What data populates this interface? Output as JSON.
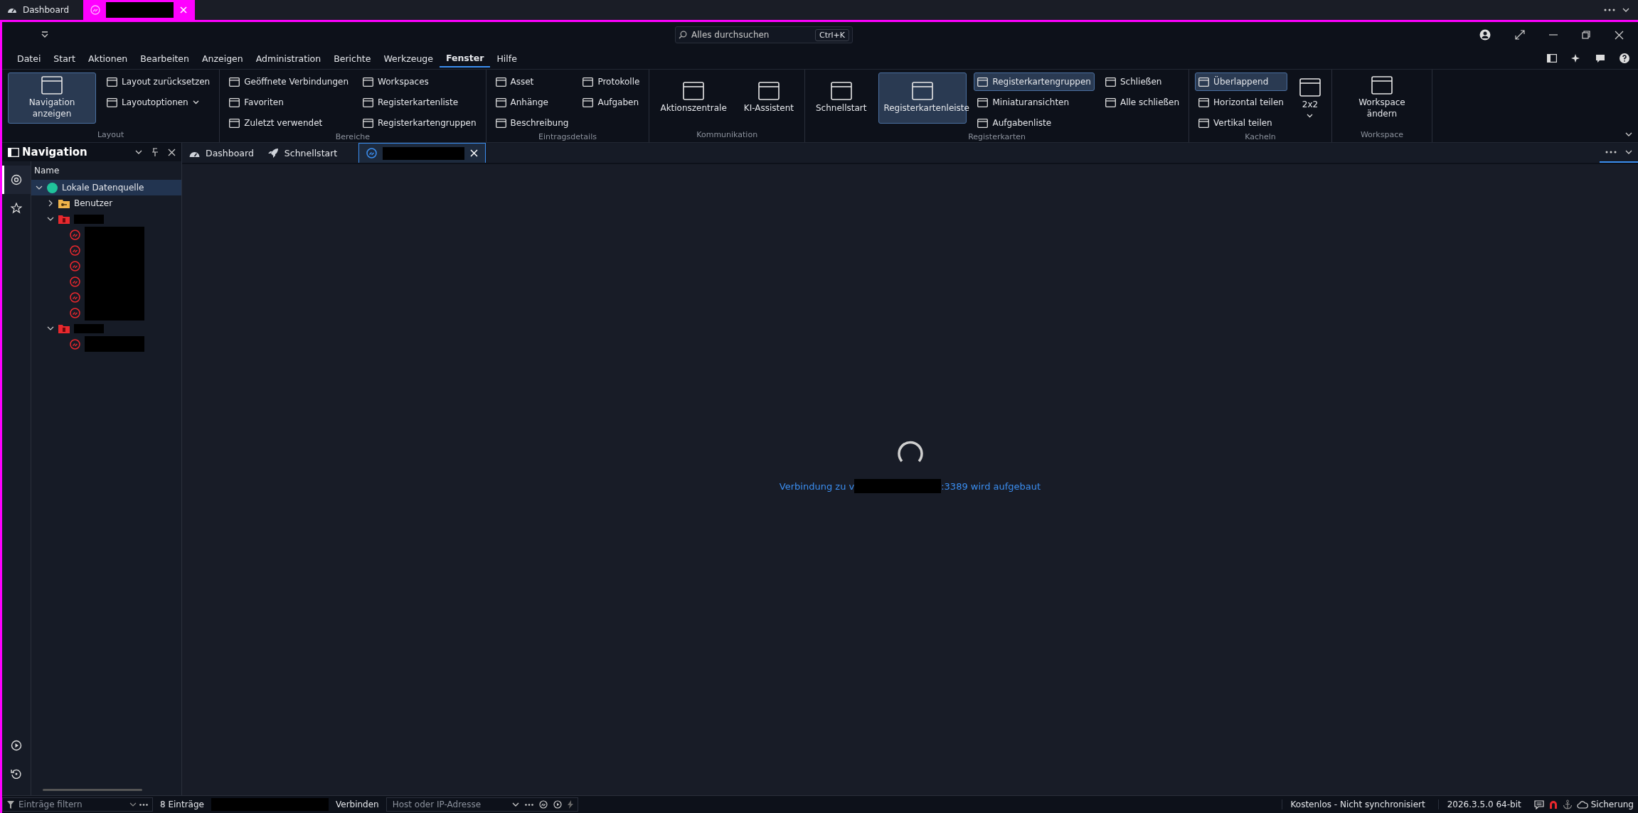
{
  "app_tabs": [
    {
      "label": "Dashboard",
      "kind": "dashboard",
      "selected": false
    },
    {
      "kind": "redacted",
      "selected": true
    }
  ],
  "search": {
    "placeholder": "Alles durchsuchen",
    "shortcut": "Ctrl+K"
  },
  "menu": [
    {
      "label": "Datei",
      "selected": false
    },
    {
      "label": "Start",
      "selected": false
    },
    {
      "label": "Aktionen",
      "selected": false
    },
    {
      "label": "Bearbeiten",
      "selected": false
    },
    {
      "label": "Anzeigen",
      "selected": false
    },
    {
      "label": "Administration",
      "selected": false
    },
    {
      "label": "Berichte",
      "selected": false
    },
    {
      "label": "Werkzeuge",
      "selected": false
    },
    {
      "label": "Fenster",
      "selected": true
    },
    {
      "label": "Hilfe",
      "selected": false
    }
  ],
  "ribbon": [
    {
      "label": "Layout",
      "columns": [
        {
          "kind": "large",
          "items": [
            {
              "label": "Navigation anzeigen",
              "selected": true
            }
          ]
        },
        {
          "kind": "stack",
          "items": [
            {
              "label": "Layout zurücksetzen",
              "selected": false
            },
            {
              "label": "Layoutoptionen",
              "selected": false,
              "dropdown": true
            }
          ]
        }
      ]
    },
    {
      "label": "Bereiche",
      "columns": [
        {
          "kind": "stack",
          "items": [
            {
              "label": "Geöffnete Verbindungen",
              "selected": false
            },
            {
              "label": "Favoriten",
              "selected": false
            },
            {
              "label": "Zuletzt verwendet",
              "selected": false
            }
          ]
        },
        {
          "kind": "stack",
          "items": [
            {
              "label": "Workspaces",
              "selected": false
            },
            {
              "label": "Registerkartenliste",
              "selected": false
            },
            {
              "label": "Registerkartengruppen",
              "selected": false
            }
          ]
        }
      ]
    },
    {
      "label": "Eintragsdetails",
      "columns": [
        {
          "kind": "stack",
          "items": [
            {
              "label": "Asset",
              "selected": false
            },
            {
              "label": "Anhänge",
              "selected": false
            },
            {
              "label": "Beschreibung",
              "selected": false
            }
          ]
        },
        {
          "kind": "stack",
          "items": [
            {
              "label": "Protokolle",
              "selected": false
            },
            {
              "label": "Aufgaben",
              "selected": false
            }
          ]
        }
      ]
    },
    {
      "label": "Kommunikation",
      "columns": [
        {
          "kind": "large",
          "items": [
            {
              "label": "Aktionszentrale",
              "selected": false
            }
          ]
        },
        {
          "kind": "large",
          "items": [
            {
              "label": "KI-Assistent",
              "selected": false
            }
          ]
        }
      ]
    },
    {
      "label": "Registerkarten",
      "columns": [
        {
          "kind": "large",
          "items": [
            {
              "label": "Schnellstart",
              "selected": false
            }
          ]
        },
        {
          "kind": "large",
          "items": [
            {
              "label": "Registerkartenleiste",
              "selected": true
            }
          ]
        },
        {
          "kind": "stack",
          "items": [
            {
              "label": "Registerkartengruppen",
              "selected": true
            },
            {
              "label": "Miniaturansichten",
              "selected": false
            },
            {
              "label": "Aufgabenliste",
              "selected": false
            }
          ]
        },
        {
          "kind": "stack",
          "items": [
            {
              "label": "Schließen",
              "selected": false
            },
            {
              "label": "Alle schließen",
              "selected": false
            }
          ]
        }
      ]
    },
    {
      "label": "Kacheln",
      "columns": [
        {
          "kind": "stack",
          "items": [
            {
              "label": "Überlappend",
              "selected": true
            },
            {
              "label": "Horizontal teilen",
              "selected": false
            },
            {
              "label": "Vertikal teilen",
              "selected": false
            }
          ]
        },
        {
          "kind": "large",
          "items": [
            {
              "label": "2x2",
              "selected": false,
              "dropdown": true
            }
          ]
        }
      ]
    },
    {
      "label": "Workspace",
      "columns": [
        {
          "kind": "large",
          "items": [
            {
              "label": "Workspace ändern",
              "selected": false
            }
          ]
        }
      ]
    }
  ],
  "navigation": {
    "title": "Navigation",
    "column": "Name",
    "tree": [
      {
        "label": "Lokale Datenquelle",
        "kind": "datasource",
        "expanded": true,
        "selected": true,
        "children": [
          {
            "label": "Benutzer",
            "kind": "user-folder",
            "expanded": false,
            "selected": false
          },
          {
            "kind": "folder",
            "expanded": true,
            "selected": false,
            "children": [
              {
                "kind": "connection",
                "selected": false
              },
              {
                "kind": "connection",
                "selected": false
              },
              {
                "kind": "connection",
                "selected": false
              },
              {
                "kind": "connection",
                "selected": false
              },
              {
                "kind": "connection",
                "selected": false
              },
              {
                "kind": "connection",
                "selected": false
              }
            ]
          },
          {
            "kind": "folder",
            "expanded": true,
            "selected": false,
            "children": [
              {
                "kind": "connection",
                "selected": false
              }
            ]
          }
        ]
      }
    ]
  },
  "doc_tabs": [
    {
      "label": "Dashboard",
      "kind": "dashboard",
      "selected": false
    },
    {
      "label": "Schnellstart",
      "kind": "rocket",
      "selected": false
    },
    {
      "kind": "connection",
      "selected": true
    }
  ],
  "message": {
    "before": "Verbindung zu v",
    "after": ":3389 wird aufgebaut"
  },
  "status_bar": {
    "filter_placeholder": "Einträge filtern",
    "count": "8 Einträge",
    "connect": "Verbinden",
    "host_placeholder": "Host oder IP-Adresse",
    "license": "Kostenlos - Nicht synchronisiert",
    "version": "2026.3.5.0 64-bit",
    "backup": "Sicherung"
  }
}
